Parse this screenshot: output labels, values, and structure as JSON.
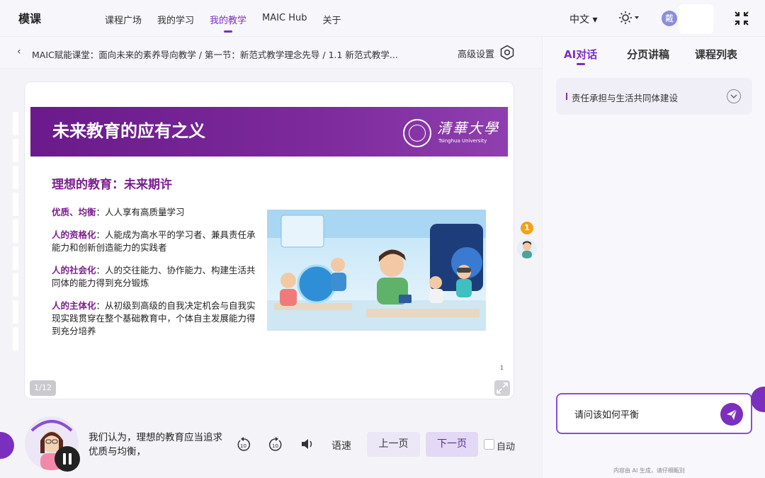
{
  "app": {
    "logo": "模课"
  },
  "nav": {
    "links": [
      "课程广场",
      "我的学习",
      "我的教学",
      "MAIC Hub",
      "关于"
    ],
    "active_index": 2,
    "language": "中文 ▾",
    "avatar_text": "戴"
  },
  "breadcrumb": {
    "text": "MAIC赋能课堂：面向未来的素养导向教学 / 第一节：新范式教学理念先导 / 1.1 新范式教学...",
    "settings_label": "高级设置"
  },
  "slide": {
    "title": "未来教育的应有之义",
    "university_cn": "清華大學",
    "university_en": "Tsinghua University",
    "subtitle": "理想的教育：未来期许",
    "points": [
      {
        "keyword": "优质、均衡",
        "text": "：人人享有高质量学习"
      },
      {
        "keyword": "人的资格化",
        "text": "：人能成为高水平的学习者、兼具责任承能力和创新创造能力的实践者"
      },
      {
        "keyword": "人的社会化",
        "text": "：人的交往能力、协作能力、构建生活共同体的能力得到充分锻炼"
      },
      {
        "keyword": "人的主体化",
        "text": "：从初级到高级的自我决定机会与自我实现实践贯穿在整个基础教育中，个体自主发展能力得到充分培养"
      }
    ],
    "corner_page": "1",
    "page_indicator": "1/12"
  },
  "float": {
    "notification_count": "1"
  },
  "player": {
    "caption": "我们认为，理想的教育应当追求优质与均衡，",
    "rewind_label": "10",
    "forward_label": "10",
    "speed_label": "语速",
    "prev_label": "上一页",
    "next_label": "下一页",
    "auto_label": "自动",
    "auto_checked": false
  },
  "right_panel": {
    "tabs": [
      "AI对话",
      "分页讲稿",
      "课程列表"
    ],
    "active_tab": 0,
    "topic": "责任承担与生活共同体建设",
    "input_value": "请问该如何平衡",
    "footnote": "内容由 AI 生成，请仔细甄别"
  },
  "colors": {
    "accent": "#7b2fbf",
    "banner": "#6a1a8a",
    "keyword": "#7b1f8f",
    "notification": "#f2a21a"
  }
}
